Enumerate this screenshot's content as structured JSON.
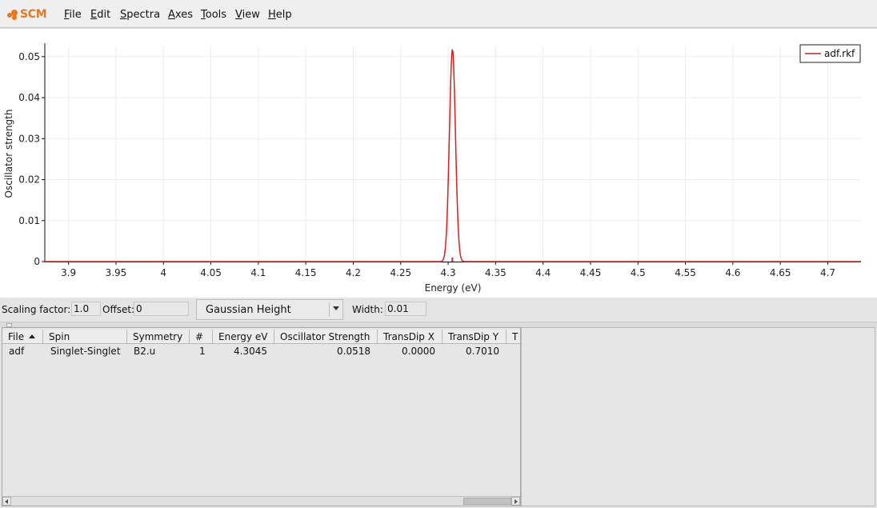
{
  "app": {
    "brand": "SCM",
    "brand_color": "#e8781e"
  },
  "menu": {
    "items": [
      "File",
      "Edit",
      "Spectra",
      "Axes",
      "Tools",
      "View",
      "Help"
    ]
  },
  "chart_data": {
    "type": "line",
    "xlabel": "Energy (eV)",
    "ylabel": "Oscillator strength",
    "xlim": [
      3.875,
      4.735
    ],
    "ylim": [
      0,
      0.0525
    ],
    "xticks": [
      3.9,
      3.95,
      4.0,
      4.05,
      4.1,
      4.15,
      4.2,
      4.25,
      4.3,
      4.35,
      4.4,
      4.45,
      4.5,
      4.55,
      4.6,
      4.65,
      4.7
    ],
    "xtick_labels": [
      "3.9",
      "3.95",
      "4",
      "4.05",
      "4.1",
      "4.15",
      "4.2",
      "4.25",
      "4.3",
      "4.35",
      "4.4",
      "4.45",
      "4.5",
      "4.55",
      "4.6",
      "4.65",
      "4.7"
    ],
    "yticks": [
      0,
      0.01,
      0.02,
      0.03,
      0.04,
      0.05
    ],
    "ytick_labels": [
      "0",
      "0.01",
      "0.02",
      "0.03",
      "0.04",
      "0.05"
    ],
    "grid": true,
    "legend_position": "top-right",
    "series": [
      {
        "name": "adf.rkf",
        "color": "#d42020",
        "peaks": [
          {
            "energy": 4.3045,
            "height": 0.0518
          }
        ],
        "lineshape": "Gaussian Height",
        "width": 0.01
      }
    ]
  },
  "controls": {
    "scaling_label": "Scaling factor:",
    "scaling_value": "1.0",
    "offset_label": "Offset:",
    "offset_value": "0",
    "function_value": "Gaussian Height",
    "width_label": "Width:",
    "width_value": "0.01"
  },
  "table": {
    "columns": [
      "File",
      "Spin",
      "Symmetry",
      "#",
      "Energy eV",
      "Oscillator Strength",
      "TransDip X",
      "TransDip Y",
      "T"
    ],
    "rows": [
      [
        "adf",
        "Singlet-Singlet",
        "B2.u",
        "1",
        "4.3045",
        "0.0518",
        "0.0000",
        "0.7010",
        ""
      ]
    ]
  }
}
